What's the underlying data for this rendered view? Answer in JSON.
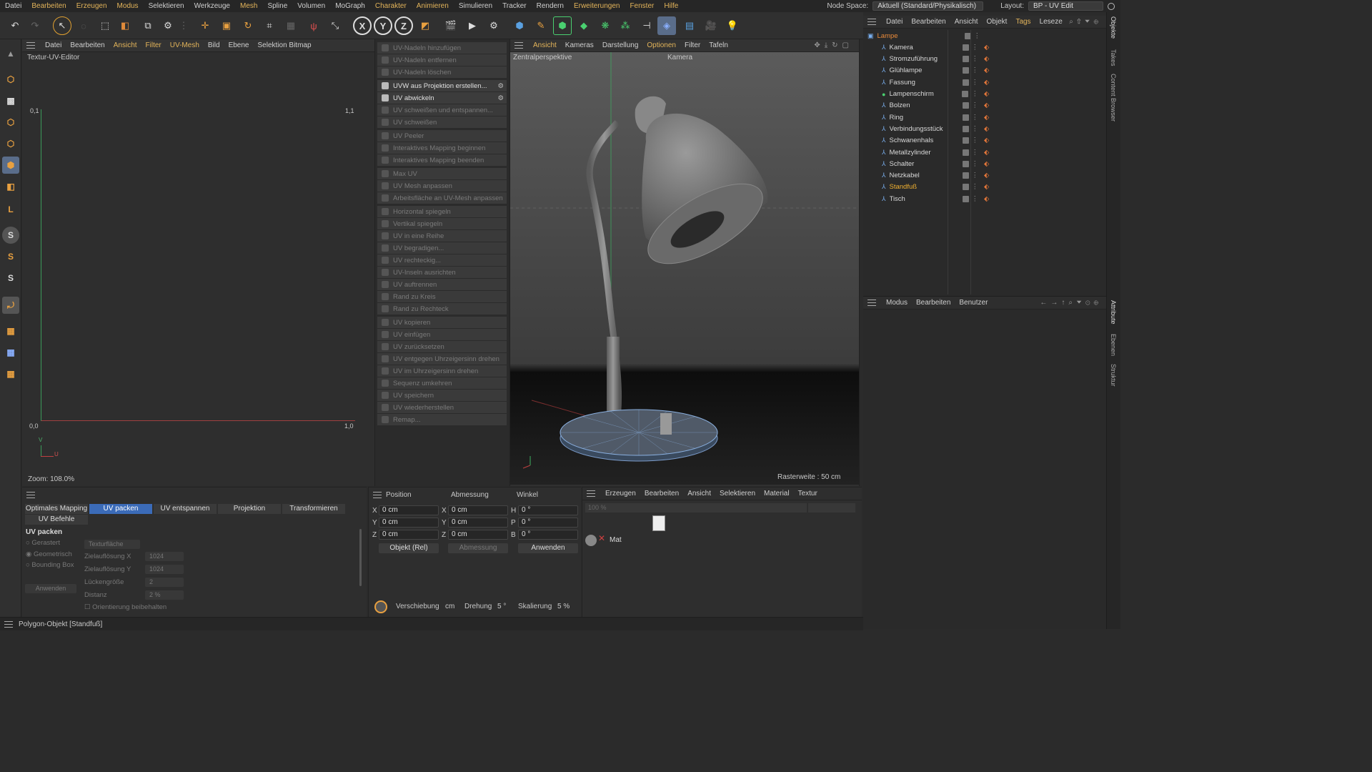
{
  "menubar": {
    "items": [
      "Datei",
      "Bearbeiten",
      "Erzeugen",
      "Modus",
      "Selektieren",
      "Werkzeuge",
      "Mesh",
      "Spline",
      "Volumen",
      "MoGraph",
      "Charakter",
      "Animieren",
      "Simulieren",
      "Tracker",
      "Rendern",
      "Erweiterungen",
      "Fenster",
      "Hilfe"
    ],
    "highlight_color": "#e3b45a",
    "nodespace_label": "Node Space:",
    "nodespace_value": "Aktuell (Standard/Physikalisch)",
    "layout_label": "Layout:",
    "layout_value": "BP - UV Edit"
  },
  "uv_editor": {
    "menu": [
      "Datei",
      "Bearbeiten",
      "Ansicht",
      "Filter",
      "UV-Mesh",
      "Bild",
      "Ebene",
      "Selektion Bitmap"
    ],
    "title": "Textur-UV-Editor",
    "tl": "0,1",
    "tr": "1,1",
    "bl": "0,0",
    "br": "1,0",
    "axis_v": "V",
    "axis_u": "U",
    "zoom": "Zoom: 108.0%"
  },
  "uv_commands": [
    {
      "label": "UV-Nadeln hinzufügen",
      "enabled": false
    },
    {
      "label": "UV-Nadeln entfernen",
      "enabled": false
    },
    {
      "label": "UV-Nadeln löschen",
      "enabled": false
    },
    {
      "label": "UVW aus Projektion erstellen...",
      "enabled": true
    },
    {
      "label": "UV abwickeln",
      "enabled": true
    },
    {
      "label": "UV schweißen und entspannen...",
      "enabled": false
    },
    {
      "label": "UV schweißen",
      "enabled": false
    },
    {
      "label": "UV Peeler",
      "enabled": false
    },
    {
      "label": "Interaktives Mapping beginnen",
      "enabled": false
    },
    {
      "label": "Interaktives Mapping beenden",
      "enabled": false
    },
    {
      "label": "Max UV",
      "enabled": false
    },
    {
      "label": "UV Mesh anpassen",
      "enabled": false
    },
    {
      "label": "Arbeitsfläche an UV-Mesh anpassen",
      "enabled": false
    },
    {
      "label": "Horizontal spiegeln",
      "enabled": false
    },
    {
      "label": "Vertikal spiegeln",
      "enabled": false
    },
    {
      "label": "UV in eine Reihe",
      "enabled": false
    },
    {
      "label": "UV begradigen...",
      "enabled": false
    },
    {
      "label": "UV rechteckig...",
      "enabled": false
    },
    {
      "label": "UV-Inseln ausrichten",
      "enabled": false
    },
    {
      "label": "UV auftrennen",
      "enabled": false
    },
    {
      "label": "Rand zu Kreis",
      "enabled": false
    },
    {
      "label": "Rand zu Rechteck",
      "enabled": false
    },
    {
      "label": "UV kopieren",
      "enabled": false
    },
    {
      "label": "UV einfügen",
      "enabled": false
    },
    {
      "label": "UV zurücksetzen",
      "enabled": false
    },
    {
      "label": "UV entgegen Uhrzeigersinn drehen",
      "enabled": false
    },
    {
      "label": "UV im Uhrzeigersinn drehen",
      "enabled": false
    },
    {
      "label": "Sequenz umkehren",
      "enabled": false
    },
    {
      "label": "UV speichern",
      "enabled": false
    },
    {
      "label": "UV wiederherstellen",
      "enabled": false
    },
    {
      "label": "Remap...",
      "enabled": false
    }
  ],
  "viewport": {
    "menu": [
      "Ansicht",
      "Kameras",
      "Darstellung",
      "Optionen",
      "Filter",
      "Tafeln"
    ],
    "perspective": "Zentralperspektive",
    "camera": "Kamera",
    "grid": "Rasterweite : 50 cm"
  },
  "object_manager": {
    "menu": [
      "Datei",
      "Bearbeiten",
      "Ansicht",
      "Objekt",
      "Tags",
      "Leseze"
    ],
    "objects": [
      {
        "name": "Lampe",
        "color": "#e88a3a"
      },
      {
        "name": "Kamera",
        "color": "#d8d8d8"
      },
      {
        "name": "Stromzuführung",
        "color": "#d8d8d8"
      },
      {
        "name": "Glühlampe",
        "color": "#d8d8d8"
      },
      {
        "name": "Fassung",
        "color": "#d8d8d8"
      },
      {
        "name": "Lampenschirm",
        "color": "#d8d8d8"
      },
      {
        "name": "Bolzen",
        "color": "#d8d8d8"
      },
      {
        "name": "Ring",
        "color": "#d8d8d8"
      },
      {
        "name": "Verbindungsstück",
        "color": "#d8d8d8"
      },
      {
        "name": "Schwanenhals",
        "color": "#d8d8d8"
      },
      {
        "name": "Metallzylinder",
        "color": "#d8d8d8"
      },
      {
        "name": "Schalter",
        "color": "#d8d8d8"
      },
      {
        "name": "Netzkabel",
        "color": "#d8d8d8"
      },
      {
        "name": "Standfuß",
        "color": "#f0b030"
      },
      {
        "name": "Tisch",
        "color": "#d8d8d8"
      }
    ]
  },
  "attributes": {
    "menu": [
      "Modus",
      "Bearbeiten",
      "Benutzer"
    ]
  },
  "right_tabs": [
    "Objekte",
    "Takes",
    "Content Browser",
    "Attribute",
    "Ebenen",
    "Struktur"
  ],
  "uv_pack": {
    "tabs": [
      "Optimales Mapping",
      "UV packen",
      "UV entspannen",
      "Projektion",
      "Transformieren"
    ],
    "tab2": "UV Befehle",
    "section": "UV packen",
    "options": [
      "Gerastert",
      "Geometrisch",
      "Bounding Box"
    ],
    "texture_dd": "Texturfläche",
    "fields": [
      {
        "label": "Zielauflösung X",
        "value": "1024"
      },
      {
        "label": "Zielauflösung Y",
        "value": "1024"
      },
      {
        "label": "Lückengröße",
        "value": "2"
      },
      {
        "label": "Distanz",
        "value": "2 %"
      }
    ],
    "apply": "Anwenden",
    "keep_orient": "Orientierung beibehalten"
  },
  "coords": {
    "headers": [
      "Position",
      "Abmessung",
      "Winkel"
    ],
    "rows": [
      {
        "a": "X",
        "av": "0 cm",
        "b": "X",
        "bv": "0 cm",
        "c": "H",
        "cv": "0 °"
      },
      {
        "a": "Y",
        "av": "0 cm",
        "b": "Y",
        "bv": "0 cm",
        "c": "P",
        "cv": "0 °"
      },
      {
        "a": "Z",
        "av": "0 cm",
        "b": "Z",
        "bv": "0 cm",
        "c": "B",
        "cv": "0 °"
      }
    ],
    "mode": "Objekt (Rel)",
    "size": "Abmessung",
    "apply": "Anwenden",
    "shift_label": "Verschiebung",
    "shift_unit": "cm",
    "rot_label": "Drehung",
    "rot_val": "5 °",
    "scale_label": "Skalierung",
    "scale_val": "5 %"
  },
  "material": {
    "menu": [
      "Erzeugen",
      "Bearbeiten",
      "Ansicht",
      "Selektieren",
      "Material",
      "Textur"
    ],
    "zoom": "100 %",
    "mat_name": "Mat"
  },
  "status": "Polygon-Objekt [Standfuß]"
}
